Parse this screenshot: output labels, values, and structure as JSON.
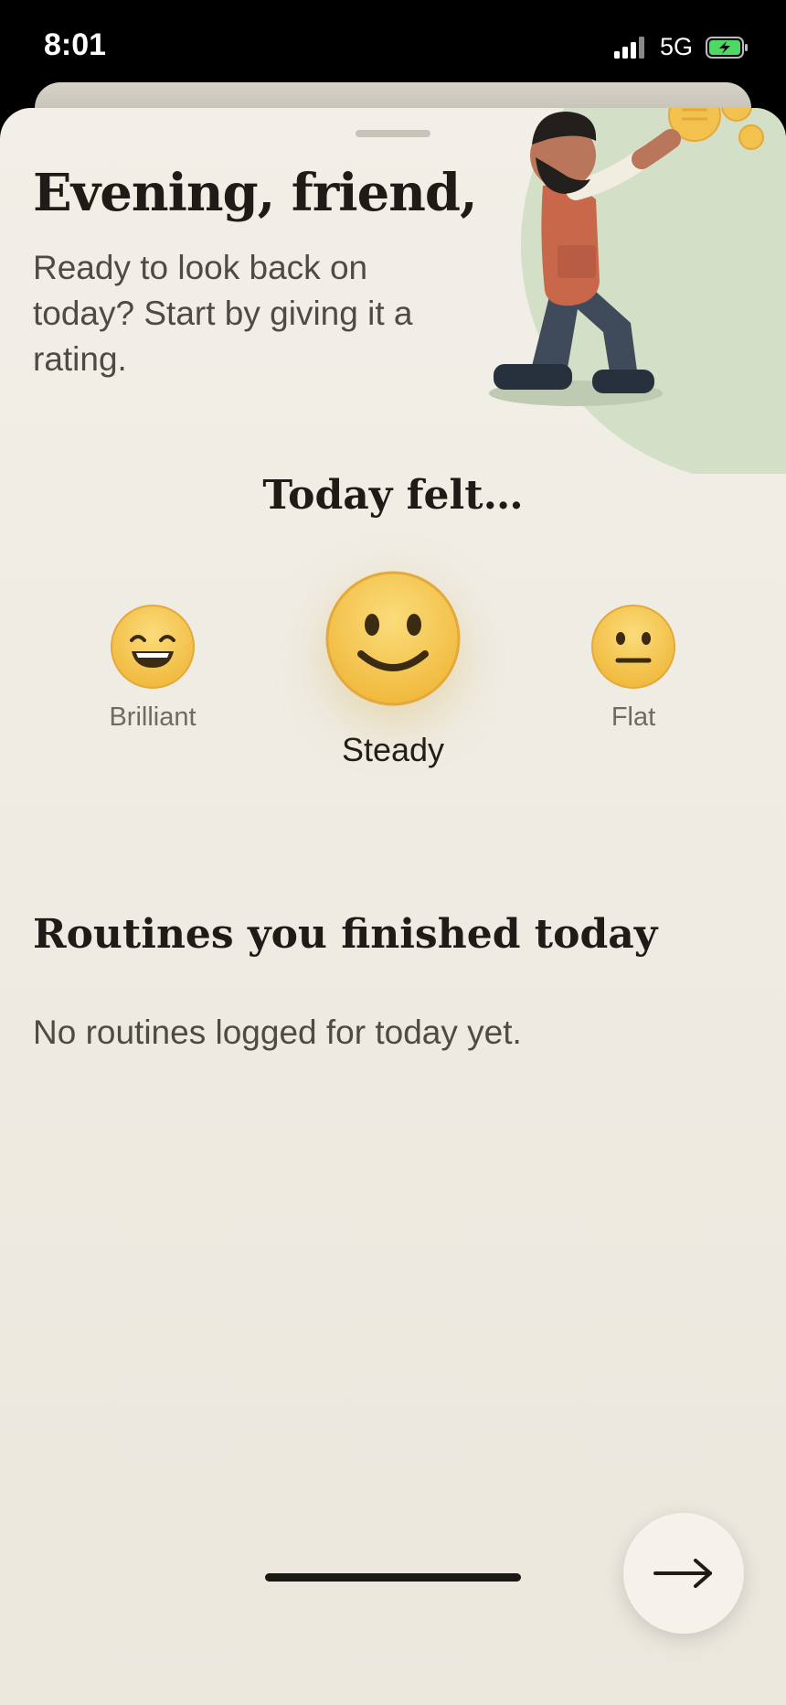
{
  "status_bar": {
    "time": "8:01",
    "network": "5G",
    "icons": [
      "signal-bars-icon",
      "battery-charging-icon"
    ]
  },
  "header": {
    "greeting": "Evening, friend,",
    "intro": "Ready to look back on today? Start by giving it a rating."
  },
  "rating": {
    "question": "Today felt…",
    "options": [
      {
        "label": "Brilliant",
        "icon": "grinning-face-icon",
        "selected": false
      },
      {
        "label": "Steady",
        "icon": "smiling-face-icon",
        "selected": true
      },
      {
        "label": "Flat",
        "icon": "neutral-face-icon",
        "selected": false
      }
    ]
  },
  "routines": {
    "title": "Routines you finished today",
    "empty_message": "No routines logged for today yet."
  },
  "next_button": {
    "icon": "arrow-right-icon"
  },
  "colors": {
    "background": "#EDE9DF",
    "text_primary": "#1F1C17",
    "text_secondary": "#4F4B44",
    "face_fill": "#F5C95A",
    "face_stroke": "#E3A93A",
    "illustration_circle": "#D3DFC6"
  }
}
